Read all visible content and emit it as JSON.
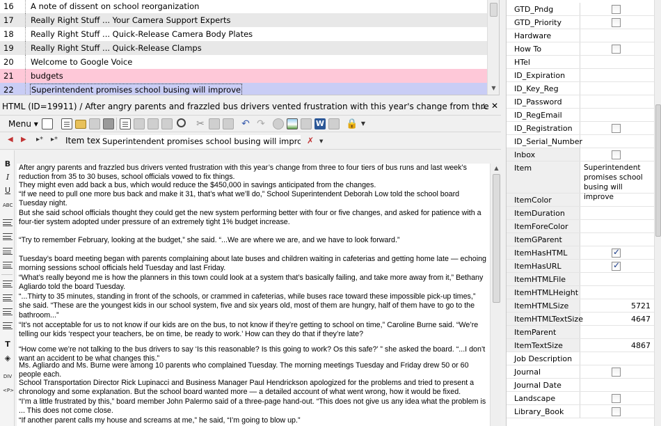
{
  "list": {
    "rows": [
      {
        "num": "16",
        "title": "A note of dissent on school reorganization",
        "bg": "#ffffff"
      },
      {
        "num": "17",
        "title": "Really Right Stuff ... Your Camera Support Experts",
        "bg": "#e8e8e8"
      },
      {
        "num": "18",
        "title": "Really Right Stuff ... Quick-Release Camera Body Plates",
        "bg": "#ffffff"
      },
      {
        "num": "19",
        "title": "Really Right Stuff ... Quick-Release Clamps",
        "bg": "#e8e8e8"
      },
      {
        "num": "20",
        "title": "Welcome to Google Voice",
        "bg": "#ffffff"
      },
      {
        "num": "21",
        "title": "budgets",
        "bg": "#fec8d8"
      },
      {
        "num": "22",
        "title": "Superintendent promises school busing will improve",
        "bg": "#c9cdf5",
        "selected": true
      }
    ]
  },
  "pane": {
    "header": "HTML (ID=19911)  / After angry parents and frazzled bus drivers vented frustration with this year's change from thre",
    "pin_glyph": "⊥",
    "close_glyph": "✕",
    "menu_label": "Menu",
    "item_text_label": "Item text",
    "item_text_value": "Superintendent promises school busing will improve"
  },
  "sidebar_labels": [
    "B",
    "I",
    "U",
    "ABC",
    "DIV",
    "<P>"
  ],
  "editor": {
    "paragraphs": [
      "After angry parents and frazzled bus drivers vented frustration with this year’s change from three to four tiers of bus runs and last week’s reduction from 35 to 30 buses, school officials vowed to fix things.",
      "They might even add back a bus, which would reduce the $450,000 in savings anticipated from the changes.",
      "“If we need to pull one more bus back and make it 31, that’s what we’ll do,” School Superintendent Deborah Low told the school board Tuesday night.",
      "But she said school officials thought they could get the new system performing better with four or five changes, and asked for patience with a four-tier system adopted under pressure of an extremely tight 1% budget increase.",
      "“Try to remember February, looking at the budget,” she said. “...We are where we are, and we have to look forward.”",
      "Tuesday’s board meeting began with parents complaining about late buses and children waiting in cafeterias and getting home late — echoing morning sessions school officials held Tuesday and last Friday.",
      "“What’s really beyond me is how the planners in this town could look at a system that’s basically failing, and take more away from it,” Bethany Agliardo told the board Tuesday.",
      "“...Thirty to 35 minutes, standing in front of the schools, or crammed in cafeterias, while buses race toward these impossible pick-up times,” she said. “These are the youngest kids in our school system, five and six years old, most of them are hungry, half of them have to go to the bathroom...”",
      "“It’s not acceptable for us to not know if our kids are on the bus, to not know if they’re getting to school on time,” Caroline Burne said. “We’re telling our kids ‘respect your teachers, be on time, be ready to work.’ How can they do that if they’re late?",
      "“How come we’re not talking to the bus drivers to say ‘Is this reasonable? Is this going to work? Os this safe?’ ” she asked the board. “...I don’t want an accident to be what changes this.”",
      "Ms. Agliardo and Ms. Burne were among 10 parents who complained Tuesday. The morning meetings Tuesday and Friday drew 50 or 60 people each.",
      "School Transportation Director Rick Lupinacci and Business Manager Paul Hendrickson apologized for the problems and tried to present a chronology and some explanation. But the school board wanted more — a detailed account of what went wrong, how it would be fixed.",
      "“I’m a little frustrated by this,” board member John Palermo said of a three-page hand-out. “This does not give us any idea what the problem is ... This does not come close.",
      "“If another parent calls my house and screams at me,” he said, “I’m going to blow up.”"
    ]
  },
  "props": [
    {
      "name": "GTD_Pndg",
      "type": "check",
      "checked": false
    },
    {
      "name": "GTD_Priority",
      "type": "check",
      "checked": false
    },
    {
      "name": "Hardware",
      "type": "text",
      "value": ""
    },
    {
      "name": "How To",
      "type": "check",
      "checked": false
    },
    {
      "name": "HTel",
      "type": "text",
      "value": ""
    },
    {
      "name": "ID_Expiration",
      "type": "text",
      "value": ""
    },
    {
      "name": "ID_Key_Reg",
      "type": "text",
      "value": ""
    },
    {
      "name": "ID_Password",
      "type": "text",
      "value": ""
    },
    {
      "name": "ID_RegEmail",
      "type": "text",
      "value": ""
    },
    {
      "name": "ID_Registration",
      "type": "check",
      "checked": false
    },
    {
      "name": "ID_Serial_Number",
      "type": "text",
      "value": ""
    },
    {
      "name": "Inbox",
      "type": "check",
      "checked": false,
      "computed": true
    },
    {
      "name": "Item",
      "type": "multiline",
      "value": "Superintendent promises school busing will improve",
      "computed": true
    },
    {
      "name": "ItemColor",
      "type": "text",
      "value": "",
      "computed": true
    },
    {
      "name": "ItemDuration",
      "type": "text",
      "value": "",
      "computed": true
    },
    {
      "name": "ItemForeColor",
      "type": "text",
      "value": "",
      "computed": true
    },
    {
      "name": "ItemGParent",
      "type": "text",
      "value": "",
      "computed": true
    },
    {
      "name": "ItemHasHTML",
      "type": "check",
      "checked": true,
      "computed": true
    },
    {
      "name": "ItemHasURL",
      "type": "check",
      "checked": true,
      "computed": true
    },
    {
      "name": "ItemHTMLFile",
      "type": "text",
      "value": "",
      "computed": true
    },
    {
      "name": "ItemHTMLHeight",
      "type": "text",
      "value": "",
      "computed": true
    },
    {
      "name": "ItemHTMLSize",
      "type": "text",
      "value": "5721",
      "computed": true
    },
    {
      "name": "ItemHTMLTextSize",
      "type": "text",
      "value": "4647",
      "computed": true
    },
    {
      "name": "ItemParent",
      "type": "text",
      "value": "",
      "computed": true
    },
    {
      "name": "ItemTextSize",
      "type": "text",
      "value": "4867",
      "computed": true
    },
    {
      "name": "Job Description",
      "type": "text",
      "value": ""
    },
    {
      "name": "Journal",
      "type": "check",
      "checked": false
    },
    {
      "name": "Journal Date",
      "type": "text",
      "value": ""
    },
    {
      "name": "Landscape",
      "type": "check",
      "checked": false
    },
    {
      "name": "Library_Book",
      "type": "check",
      "checked": false
    }
  ]
}
